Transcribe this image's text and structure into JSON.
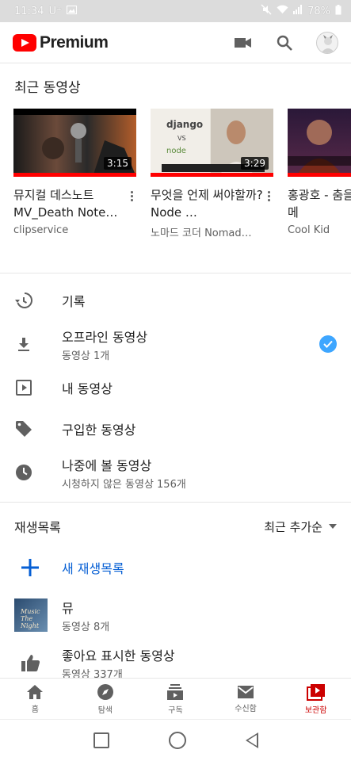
{
  "status_bar": {
    "time": "11:34",
    "carrier": "U⁺",
    "battery": "78%"
  },
  "header": {
    "logo_text": "Premium"
  },
  "recent": {
    "title": "최근 동영상",
    "videos": [
      {
        "title": "뮤지컬 데스노트 MV_Death Note…",
        "channel": "clipservice",
        "duration": "3:15"
      },
      {
        "title": "무엇을 언제 써야할까? Node …",
        "channel": "노마드 코더 Nomad…",
        "duration": "3:29"
      },
      {
        "title": "홍광호 - 춤을 나의 에스메",
        "channel": "Cool Kid",
        "duration": ""
      }
    ]
  },
  "menu": [
    {
      "label": "기록",
      "sub": ""
    },
    {
      "label": "오프라인 동영상",
      "sub": "동영상 1개"
    },
    {
      "label": "내 동영상",
      "sub": ""
    },
    {
      "label": "구입한 동영상",
      "sub": ""
    },
    {
      "label": "나중에 볼 동영상",
      "sub": "시청하지 않은 동영상 156개"
    }
  ],
  "playlists": {
    "title": "재생목록",
    "sort_label": "최근 추가순",
    "new_label": "새 재생목록",
    "items": [
      {
        "name": "뮤",
        "count": "동영상 8개",
        "thumb_text": "Music The Night"
      },
      {
        "name": "좋아요 표시한 동영상",
        "count": "동영상 337개"
      }
    ]
  },
  "bottom_nav": [
    {
      "label": "홈"
    },
    {
      "label": "탐색"
    },
    {
      "label": "구독"
    },
    {
      "label": "수신함"
    },
    {
      "label": "보관함"
    }
  ],
  "colors": {
    "accent_red": "#ff0000",
    "link_blue": "#065fd4",
    "check_blue": "#3ea6ff"
  }
}
